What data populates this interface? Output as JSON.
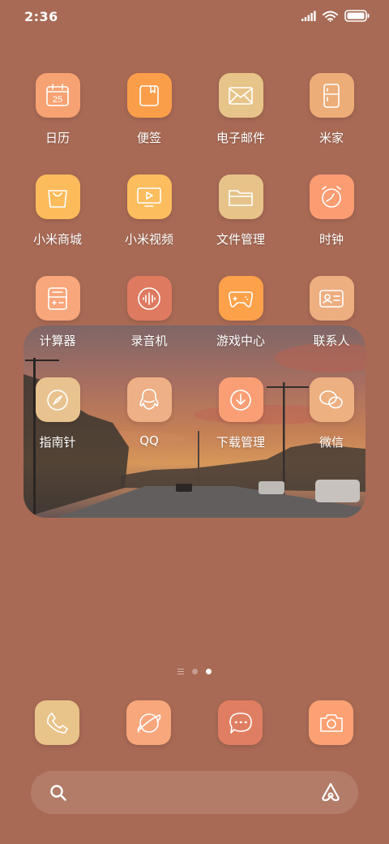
{
  "status_bar": {
    "time": "2:36"
  },
  "apps": [
    {
      "label": "日历",
      "icon": "calendar-icon",
      "color": "#f7a272",
      "day": "25"
    },
    {
      "label": "便签",
      "icon": "notes-icon",
      "color": "#fb9e49"
    },
    {
      "label": "电子邮件",
      "icon": "mail-icon",
      "color": "#e7c489"
    },
    {
      "label": "米家",
      "icon": "mijia-icon",
      "color": "#edad78"
    },
    {
      "label": "小米商城",
      "icon": "shopping-bag-icon",
      "color": "#fcbc5c"
    },
    {
      "label": "小米视频",
      "icon": "video-icon",
      "color": "#fcbd5e"
    },
    {
      "label": "文件管理",
      "icon": "folder-icon",
      "color": "#e7c38a"
    },
    {
      "label": "时钟",
      "icon": "clock-icon",
      "color": "#fb9c73"
    },
    {
      "label": "计算器",
      "icon": "calculator-icon",
      "color": "#f8a67b"
    },
    {
      "label": "录音机",
      "icon": "recorder-icon",
      "color": "#de7a60"
    },
    {
      "label": "游戏中心",
      "icon": "gamepad-icon",
      "color": "#fda24a"
    },
    {
      "label": "联系人",
      "icon": "contacts-icon",
      "color": "#edae80"
    },
    {
      "label": "指南针",
      "icon": "compass-icon",
      "color": "#e8c38f"
    },
    {
      "label": "QQ",
      "icon": "qq-icon",
      "color": "#eeb086"
    },
    {
      "label": "下载管理",
      "icon": "download-icon",
      "color": "#fa9f75"
    },
    {
      "label": "微信",
      "icon": "wechat-icon",
      "color": "#edb081"
    }
  ],
  "page_indicator": {
    "pages": 2,
    "active": 2
  },
  "dock": [
    {
      "name": "phone-icon",
      "color": "#e8c38a"
    },
    {
      "name": "browser-icon",
      "color": "#f8a67c"
    },
    {
      "name": "messages-icon",
      "color": "#df7e62"
    },
    {
      "name": "camera-icon",
      "color": "#fba174"
    }
  ],
  "search_bar": {
    "search_icon": "search-icon",
    "assistant_icon": "assistant-icon"
  }
}
